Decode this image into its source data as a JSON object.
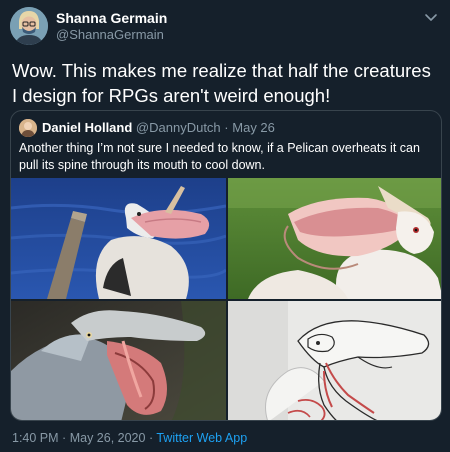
{
  "tweet": {
    "author_name": "Shanna Germain",
    "author_handle": "@ShannaGermain",
    "text": "Wow. This makes me realize that half the creatures I design for RPGs aren't weird enough!",
    "time": "1:40 PM",
    "separator": "·",
    "date": "May 26, 2020",
    "source": "Twitter Web App"
  },
  "quoted": {
    "author_name": "Daniel Holland",
    "author_handle": "@DannyDutch",
    "separator": "·",
    "date": "May 26",
    "text": "Another thing I’m not sure I needed to know, if a Pelican overheats it can pull its spine through its mouth to cool down."
  },
  "icons": {
    "menu": "chevron-down-icon"
  },
  "colors": {
    "background": "#15202b",
    "link": "#1da1f2",
    "secondary_text": "#8899a6",
    "border": "#38444d"
  }
}
